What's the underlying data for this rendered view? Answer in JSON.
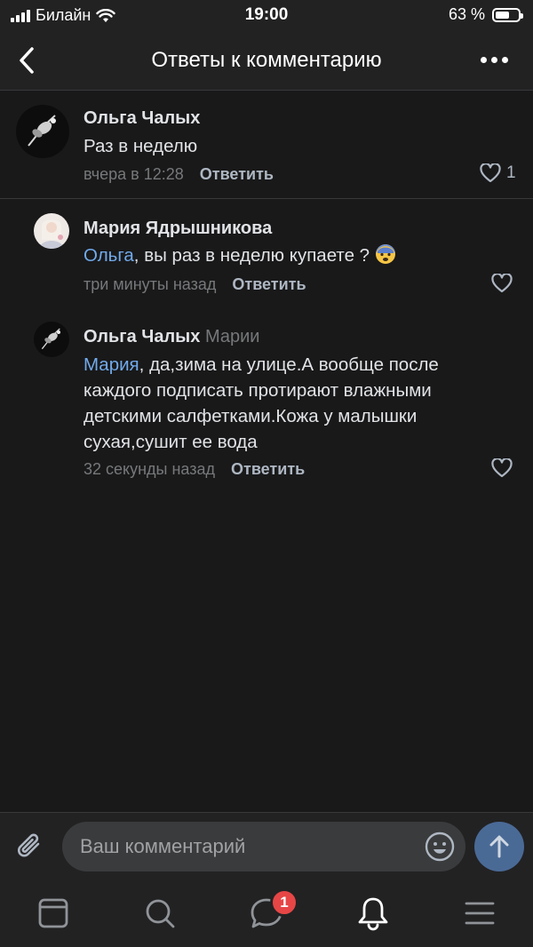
{
  "status_bar": {
    "carrier": "Билайн",
    "time": "19:00",
    "battery": "63 %",
    "battery_level": 0.63
  },
  "header": {
    "title": "Ответы к комментарию",
    "back_icon": "chevron-left-icon",
    "more_icon": "more-dots-icon"
  },
  "comments": [
    {
      "author": "Ольга Чалых",
      "reply_to": "",
      "mention": "",
      "text": "Раз в неделю",
      "time": "вчера в 12:28",
      "reply_label": "Ответить",
      "likes": "1"
    },
    {
      "author": "Мария Ядрышникова",
      "reply_to": "",
      "mention": "Ольга",
      "text": ", вы раз в неделю купаете ?",
      "emoji": "😨",
      "time": "три минуты назад",
      "reply_label": "Ответить",
      "likes": ""
    },
    {
      "author": "Ольга Чалых",
      "reply_to": "Марии",
      "mention": "Мария",
      "text_lines": [
        ", да,зима на улице.А вообще после",
        "каждого подписать протирают влажными",
        "детскими салфетками.Кожа у малышки",
        "сухая,сушит ее вода"
      ],
      "time": "32 секунды назад",
      "reply_label": "Ответить",
      "likes": ""
    }
  ],
  "composer": {
    "placeholder": "Ваш комментарий",
    "value": ""
  },
  "tab_bar": {
    "items": [
      "feed-icon",
      "search-icon",
      "messages-icon",
      "notifications-icon",
      "menu-icon"
    ],
    "active": "notifications-icon",
    "messages_badge": "1"
  },
  "colors": {
    "background": "#19191a",
    "bars": "#222223",
    "accent": "#71aaeb",
    "badge": "#e64646",
    "send": "#4a6a96"
  }
}
